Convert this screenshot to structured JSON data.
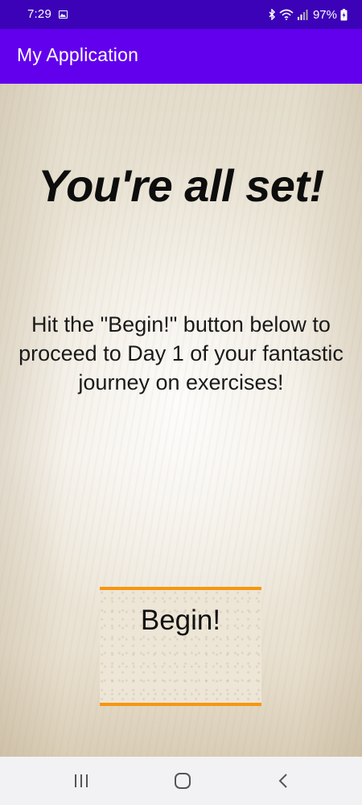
{
  "status_bar": {
    "time": "7:29",
    "battery_percent": "97%",
    "icons": [
      "image-notification-icon",
      "bluetooth-icon",
      "wifi-icon",
      "signal-icon",
      "battery-icon"
    ]
  },
  "app_bar": {
    "title": "My Application",
    "color": "#6200ee"
  },
  "main": {
    "heading": "You're all set!",
    "message": "Hit the \"Begin!\" button below to proceed to Day 1 of your fantastic journey on exercises!",
    "begin_button_label": "Begin!",
    "accent_color": "#f7960f"
  },
  "nav_bar": {
    "buttons": [
      "recent-apps-icon",
      "home-icon",
      "back-icon"
    ]
  }
}
